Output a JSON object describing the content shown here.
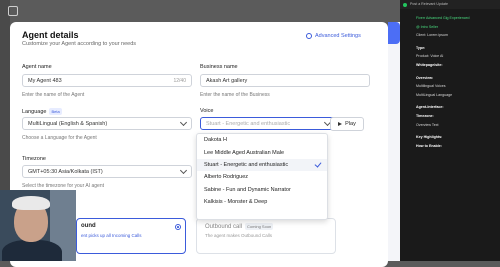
{
  "modal": {
    "title": "Agent details",
    "subtitle": "Customize your Agent according to your needs",
    "advanced_settings": "Advanced Settings"
  },
  "form": {
    "agent_name": {
      "label": "Agent name",
      "value": "My Agent 483",
      "counter": "12/40",
      "hint": "Enter the name of the Agent"
    },
    "business_name": {
      "label": "Business name",
      "value": "Akash Art gallery",
      "hint": "Enter the name of the Business"
    },
    "language": {
      "label": "Language",
      "badge": "Beta",
      "value": "MultiLingual (English & Spanish)",
      "hint": "Choose a Language for the Agent"
    },
    "voice": {
      "label": "Voice",
      "placeholder": "Stuart - Energetic and enthusiastic",
      "play": "Play"
    },
    "timezone": {
      "label": "Timezone",
      "value": "GMT+05:30 Asia/Kolkata (IST)",
      "hint": "Select the timezone for your AI agent"
    }
  },
  "voice_options": [
    {
      "label": "Dakota H",
      "selected": false
    },
    {
      "label": "Lee Middle Aged Australian Male",
      "selected": false
    },
    {
      "label": "Stuart - Energetic and enthusiastic",
      "selected": true
    },
    {
      "label": "Alberto Rodriguez",
      "selected": false
    },
    {
      "label": "Sabine - Fun and Dynamic Narrator",
      "selected": false
    },
    {
      "label": "Kalkisis - Monster & Deep",
      "selected": false
    }
  ],
  "cards": {
    "inbound": {
      "title": "ound",
      "desc": "ent picks up all Incoming Calls"
    },
    "outbound": {
      "title": "Outbound call",
      "badge": "Coming Soon",
      "desc": "The agent makes Outbound Calls"
    }
  },
  "sidebar": {
    "header": "Post a Relevant Update",
    "items": [
      "Fiverr Advanced Gig Experienced",
      "@ Intro Seller",
      "Client: Lorem ipsum",
      "Type:",
      "Product: Voice AI",
      "Whitepage/site:",
      "Overview:",
      "Multilingual Voices",
      "MultiLingual Language",
      "Agent-Interface:",
      "Timezone:",
      "Overview Text",
      "Key Highlights:",
      "How to Enable:"
    ]
  },
  "colors": {
    "accent": "#3b5bdb",
    "sidebar_bg": "#1a1a1a",
    "green": "#4ade80"
  }
}
